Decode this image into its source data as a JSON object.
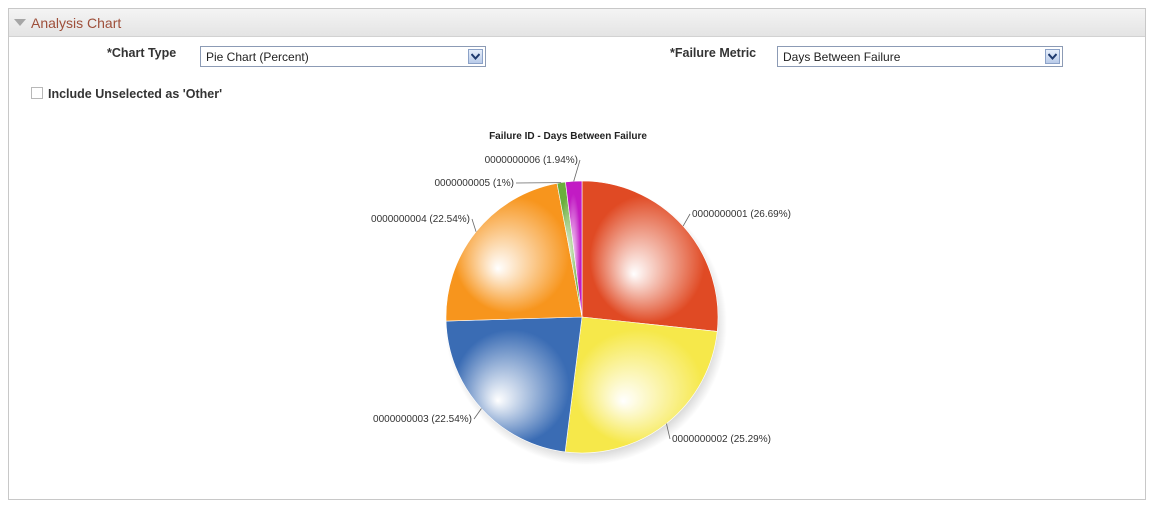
{
  "panel": {
    "title": "Analysis Chart"
  },
  "form": {
    "chart_type_label": "*Chart Type",
    "chart_type_value": "Pie Chart (Percent)",
    "failure_metric_label": "*Failure Metric",
    "failure_metric_value": "Days Between Failure",
    "include_other_label": "Include Unselected as 'Other'",
    "include_other_checked": false
  },
  "icons": {
    "collapse": "triangle-down-icon",
    "dropdown": "chevron-down-icon"
  },
  "colors": {
    "title": "#9e4f3a",
    "slice_0000000001": "#e04a24",
    "slice_0000000002": "#f6e84a",
    "slice_0000000003": "#3a6cb4",
    "slice_0000000004": "#f7951d",
    "slice_0000000005": "#6aae3c",
    "slice_0000000006": "#c21bc4"
  },
  "chart_data": {
    "type": "pie",
    "title": "Failure ID - Days Between Failure",
    "labels": [
      "0000000001 (26.69%)",
      "0000000002 (25.29%)",
      "0000000003 (22.54%)",
      "0000000004 (22.54%)",
      "0000000005 (1%)",
      "0000000006 (1.94%)"
    ],
    "categories": [
      "0000000001",
      "0000000002",
      "0000000003",
      "0000000004",
      "0000000005",
      "0000000006"
    ],
    "values": [
      26.69,
      25.29,
      22.54,
      22.54,
      1,
      1.94
    ],
    "colors": [
      "#e04a24",
      "#f6e84a",
      "#3a6cb4",
      "#f7951d",
      "#6aae3c",
      "#c21bc4"
    ]
  }
}
